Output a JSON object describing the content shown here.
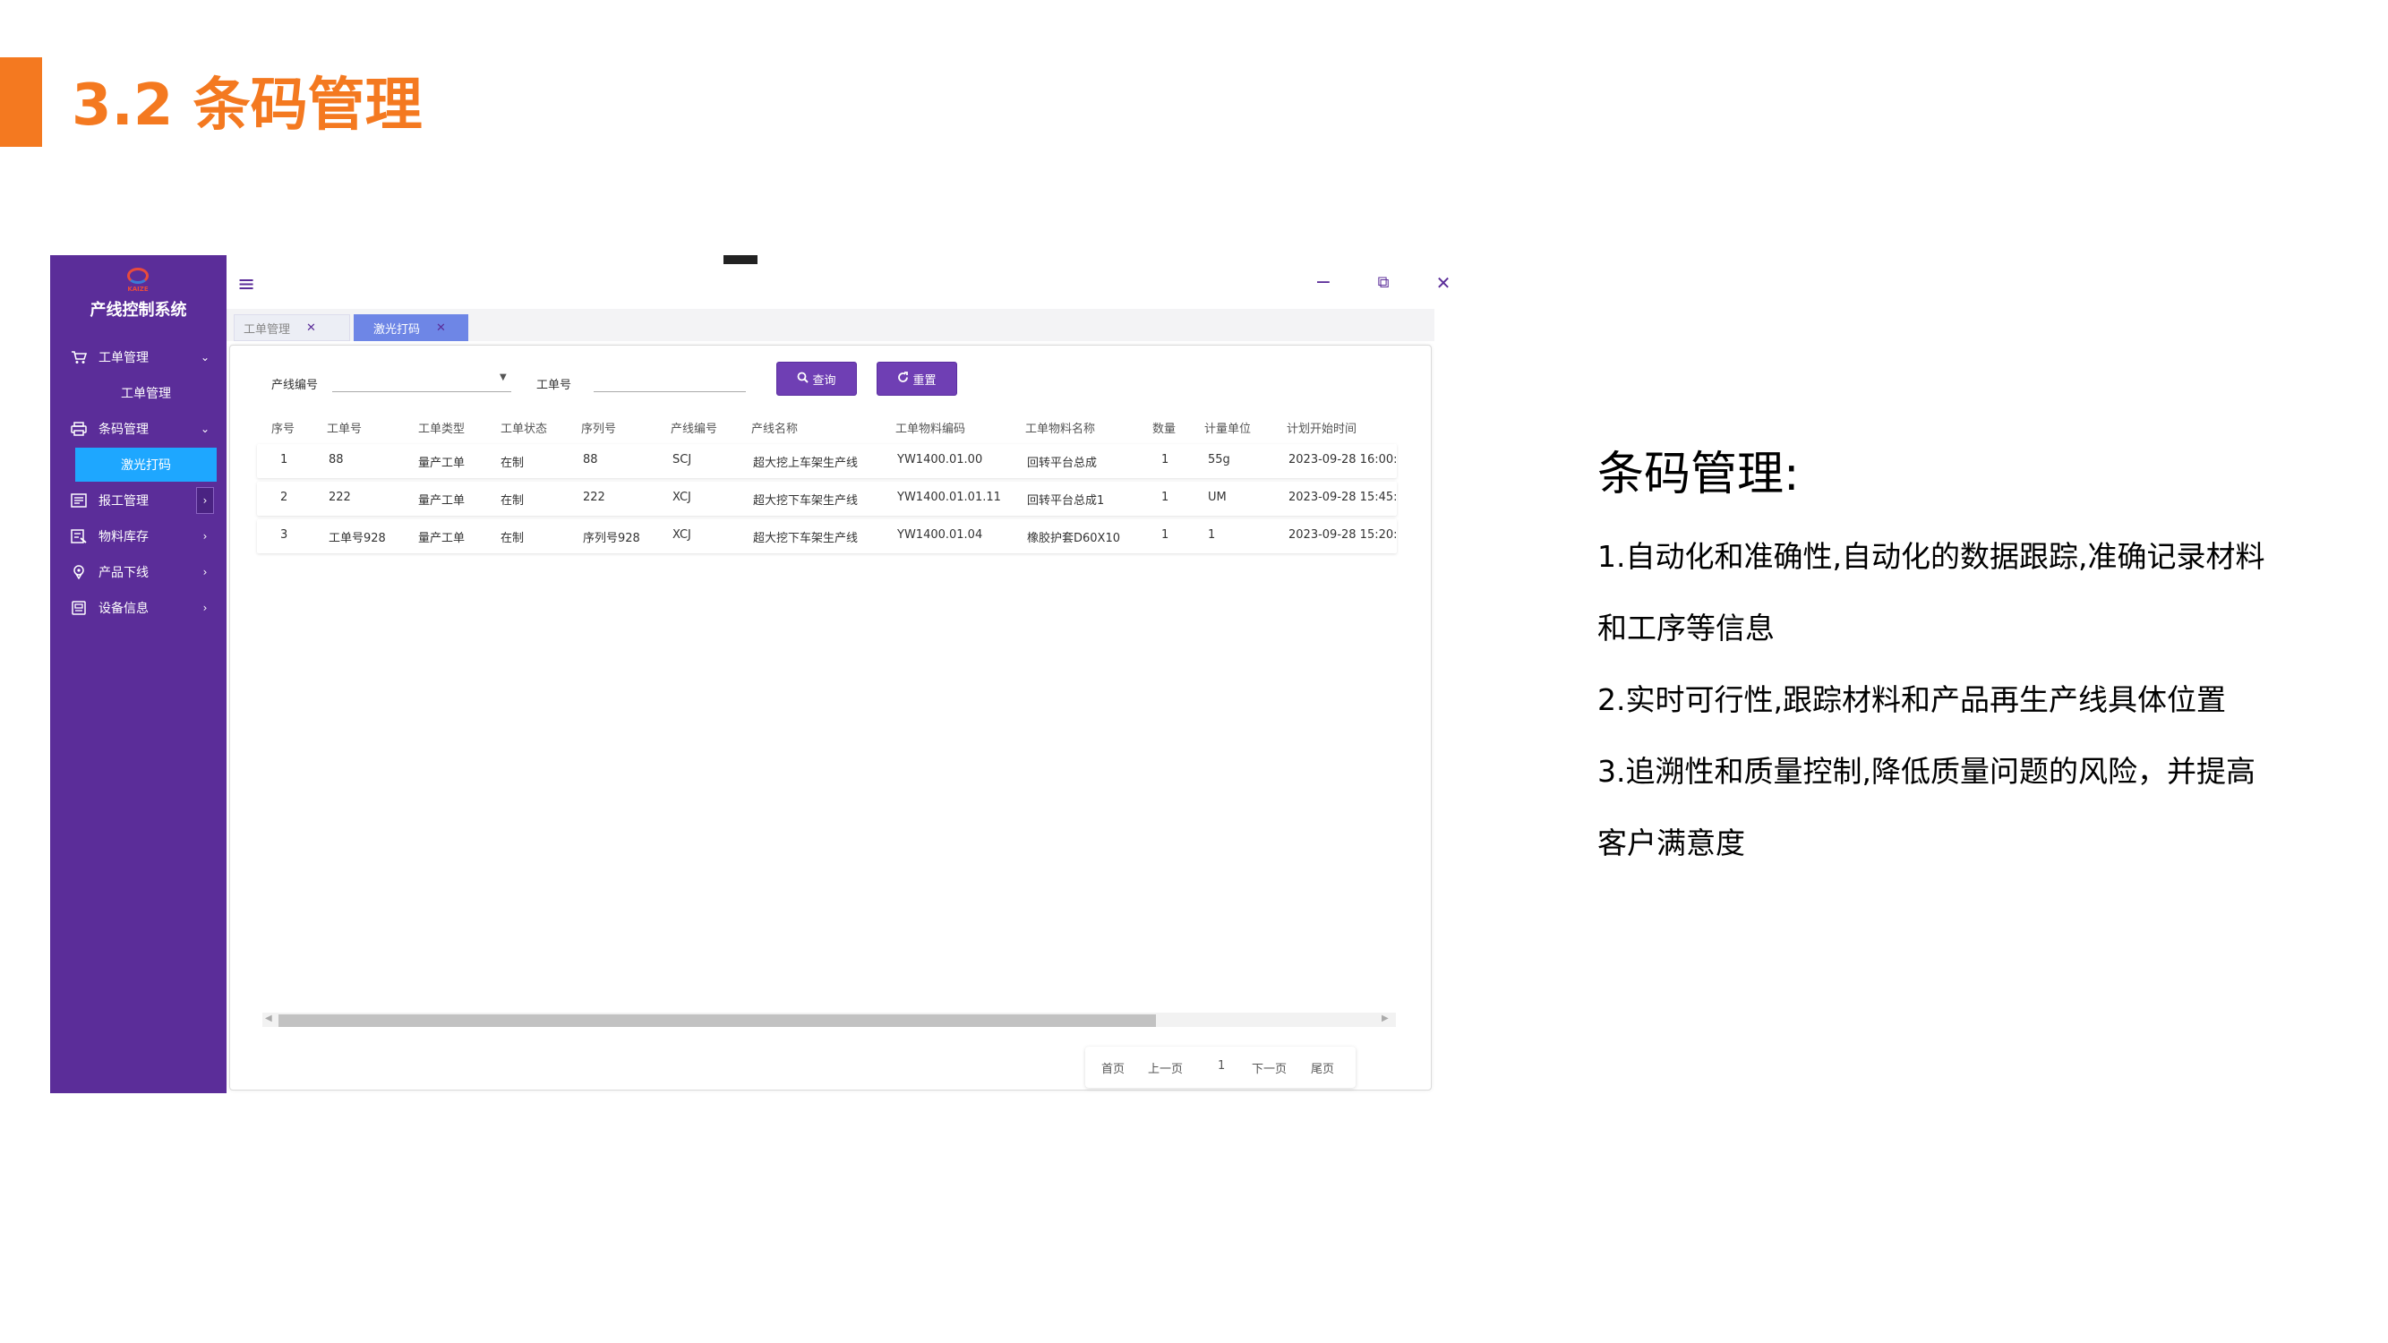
{
  "slide": {
    "title": "3.2 条码管理"
  },
  "app": {
    "logo_text": "KAIZE",
    "system_title": "产线控制系统",
    "sidebar": {
      "items": [
        {
          "label": "工单管理",
          "icon": "cart-icon",
          "arrow": "⌄"
        },
        {
          "label": "工单管理",
          "sub": true
        },
        {
          "label": "条码管理",
          "icon": "printer-icon",
          "arrow": "⌄"
        },
        {
          "label": "激光打码",
          "sub": true,
          "active": true
        },
        {
          "label": "报工管理",
          "icon": "report-icon",
          "arrow": "›"
        },
        {
          "label": "物料库存",
          "icon": "inventory-icon",
          "arrow": "›"
        },
        {
          "label": "产品下线",
          "icon": "location-icon",
          "arrow": "›"
        },
        {
          "label": "设备信息",
          "icon": "device-icon",
          "arrow": "›"
        }
      ]
    },
    "window_buttons": {
      "minimize": "−",
      "restore": "⧉",
      "close": "✕"
    },
    "tabs": [
      {
        "label": "工单管理",
        "close": "✕"
      },
      {
        "label": "激光打码",
        "close": "✕"
      }
    ],
    "filters": {
      "line_label": "产线编号",
      "line_value": "",
      "order_label": "工单号",
      "order_value": "",
      "query_button": "查询",
      "reset_button": "重置"
    },
    "table": {
      "columns": [
        "序号",
        "工单号",
        "工单类型",
        "工单状态",
        "序列号",
        "产线编号",
        "产线名称",
        "工单物料编码",
        "工单物料名称",
        "数量",
        "计量单位",
        "计划开始时间"
      ],
      "rows": [
        [
          "1",
          "88",
          "量产工单",
          "在制",
          "88",
          "SCJ",
          "超大挖上车架生产线",
          "YW1400.01.00",
          "回转平台总成",
          "1",
          "55g",
          "2023-09-28 16:00:"
        ],
        [
          "2",
          "222",
          "量产工单",
          "在制",
          "222",
          "XCJ",
          "超大挖下车架生产线",
          "YW1400.01.01.11",
          "回转平台总成1",
          "1",
          "UM",
          "2023-09-28 15:45:"
        ],
        [
          "3",
          "工单号928",
          "量产工单",
          "在制",
          "序列号928",
          "XCJ",
          "超大挖下车架生产线",
          "YW1400.01.04",
          "橡胶护套D60X10",
          "1",
          "1",
          "2023-09-28 15:20:"
        ]
      ]
    },
    "pager": {
      "first": "首页",
      "prev": "上一页",
      "current": "1",
      "next": "下一页",
      "last": "尾页"
    }
  },
  "description": {
    "title": "条码管理:",
    "lines": [
      "1.自动化和准确性,自动化的数据跟踪,准确记录材料",
      "和工序等信息",
      "2.实时可行性,跟踪材料和产品再生产线具体位置",
      "3.追溯性和质量控制,降低质量问题的风险，并提高",
      "客户满意度"
    ]
  }
}
